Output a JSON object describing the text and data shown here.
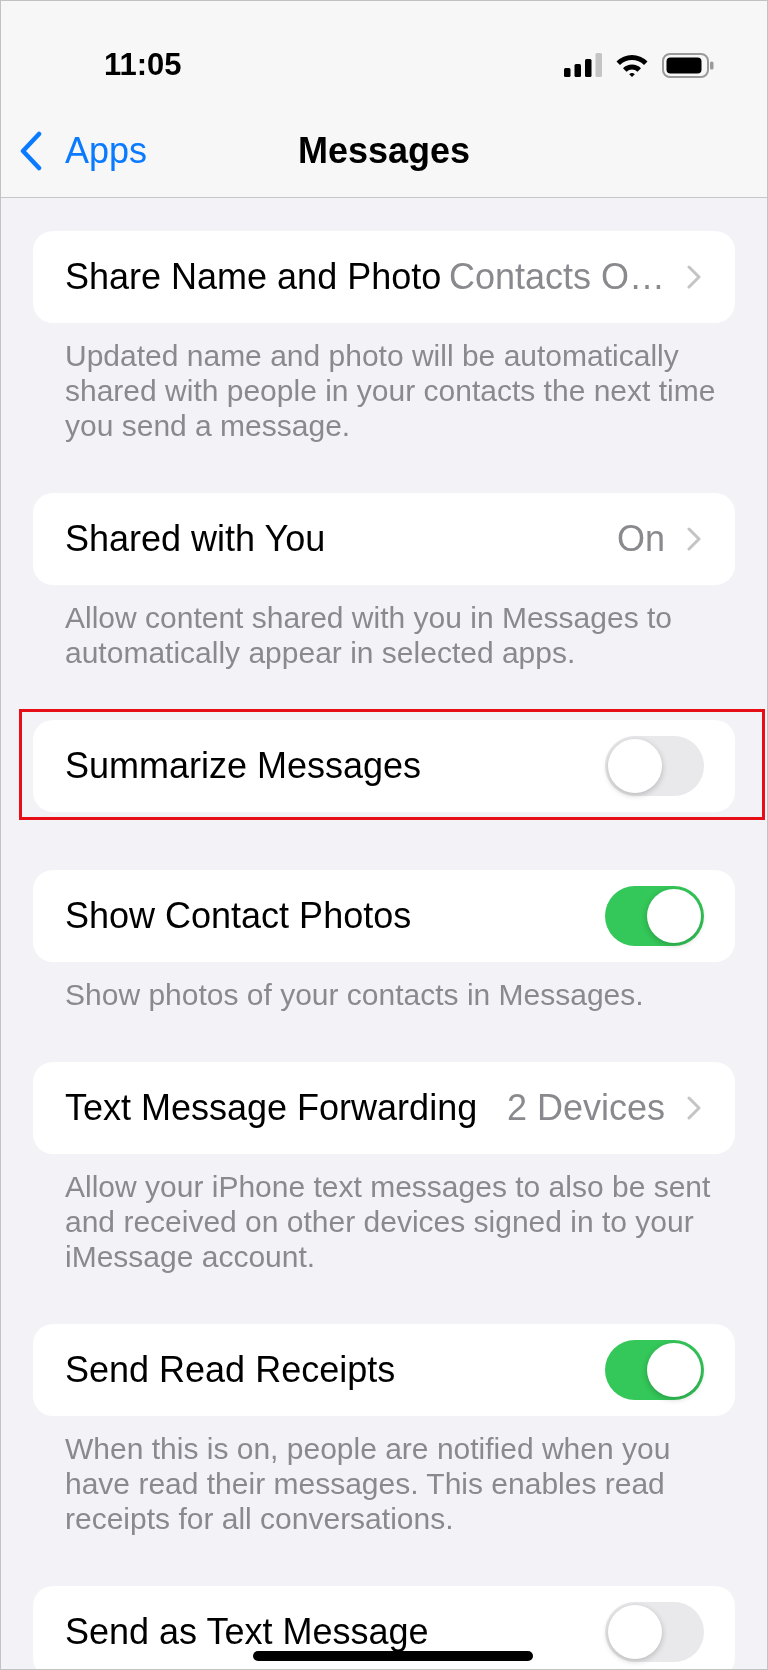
{
  "status_bar": {
    "time": "11:05"
  },
  "nav": {
    "back": "Apps",
    "title": "Messages"
  },
  "sections": [
    {
      "label": "Share Name and Photo",
      "kind": "link",
      "value": "Contacts O…",
      "highlighted": false,
      "footer": "Updated name and photo will be automatically\nshared with people in your contacts the next time\nyou send a message."
    },
    {
      "label": "Shared with You",
      "kind": "link",
      "value": "On",
      "highlighted": false,
      "footer": "Allow content shared with you in Messages to\nautomatically appear in selected apps."
    },
    {
      "label": "Summarize Messages",
      "kind": "toggle",
      "on": false,
      "highlighted": true
    },
    {
      "label": "Show Contact Photos",
      "kind": "toggle",
      "on": true,
      "highlighted": false,
      "footer": "Show photos of your contacts in Messages."
    },
    {
      "label": "Text Message Forwarding",
      "kind": "link",
      "value": "2 Devices",
      "highlighted": false,
      "footer": "Allow your iPhone text messages to also be sent\nand received on other devices signed in to your\niMessage account."
    },
    {
      "label": "Send Read Receipts",
      "kind": "toggle",
      "on": true,
      "highlighted": false,
      "footer": "When this is on, people are notified when you\nhave read their messages. This enables read\nreceipts for all conversations."
    },
    {
      "label": "Send as Text Message",
      "kind": "toggle",
      "on": false,
      "highlighted": false
    }
  ]
}
